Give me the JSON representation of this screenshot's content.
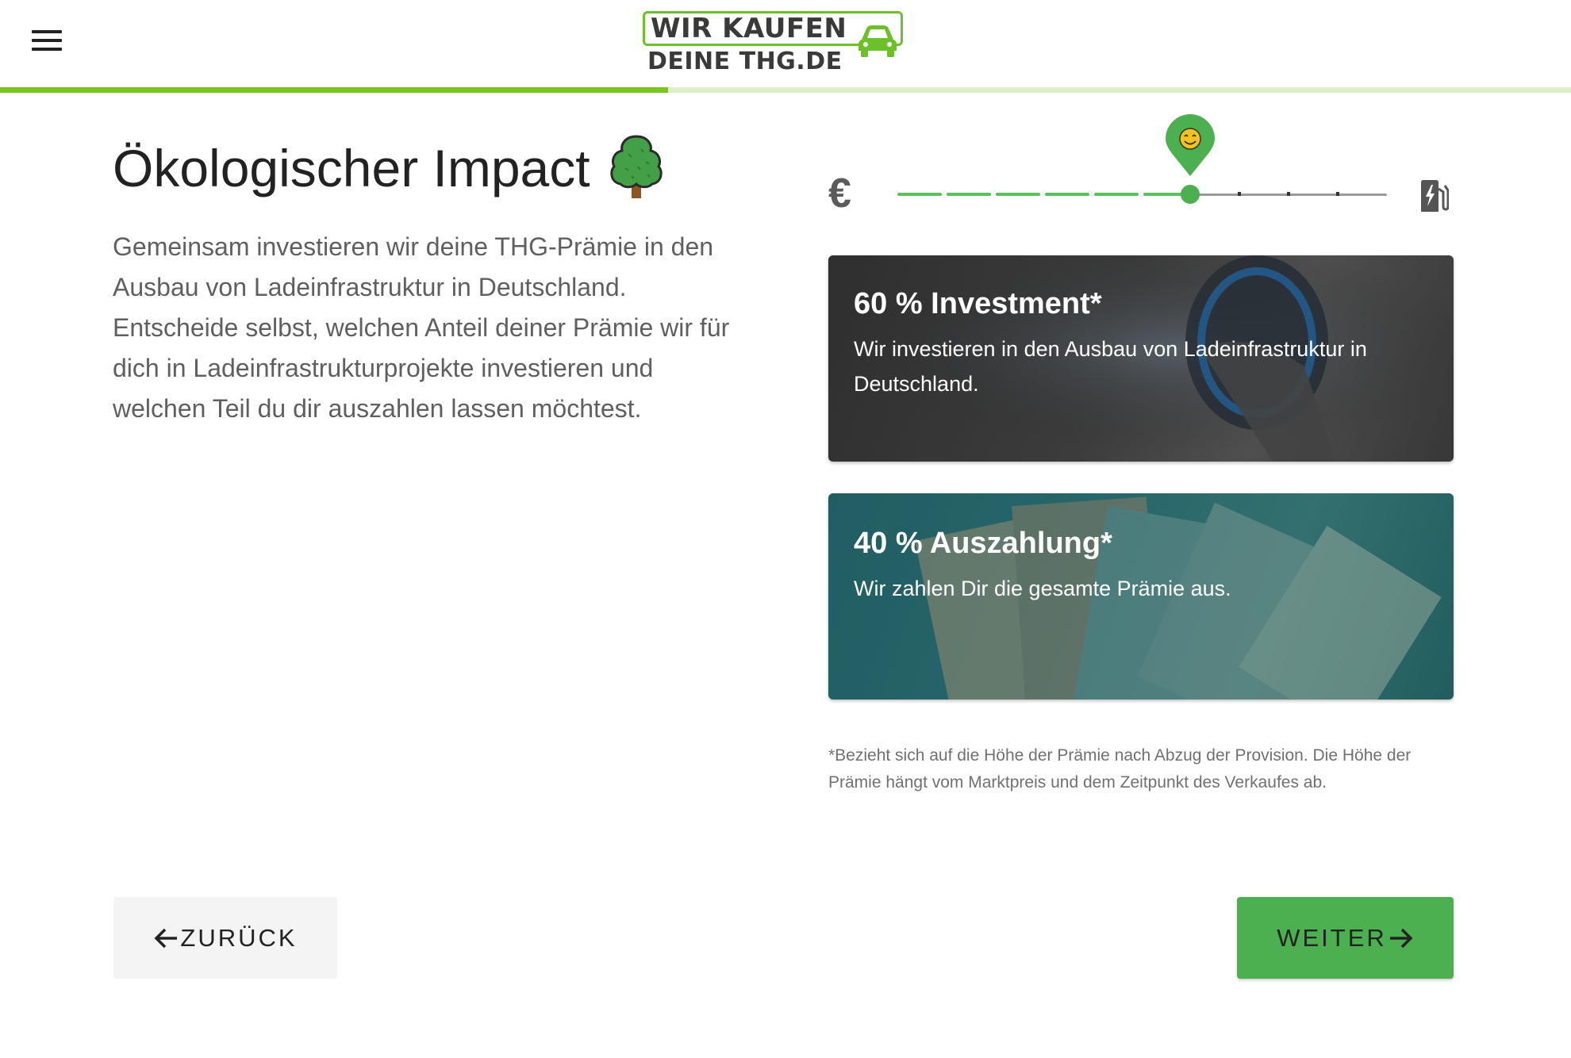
{
  "header": {
    "menu_icon": "hamburger-menu-icon",
    "logo_line1": "WIR KAUFEN",
    "logo_line2": "DEINE THG.DE",
    "logo_icon": "car-icon",
    "progress": 0.425
  },
  "main": {
    "title": "Ökologischer Impact",
    "title_icon": "tree-icon",
    "description": "Gemeinsam investieren wir deine THG-Prämie in den Ausbau von Ladeinfrastruktur in Deutschland. Entscheide selbst, welchen Anteil deiner Prämie wir für dich in Ladeinfrastrukturprojekte investieren und welchen Teil du dir auszahlen lassen möchtest."
  },
  "slider": {
    "left_icon": "euro-icon",
    "left_symbol": "€",
    "right_icon": "ev-charging-station-icon",
    "marker_icon": "smiley-pin-icon",
    "steps": 10,
    "value_step": 6
  },
  "cards": {
    "investment": {
      "title": "60 % Investment*",
      "text": "Wir investieren in den Ausbau von Ladeinfrastruktur in Deutschland."
    },
    "payout": {
      "title": "40 % Auszahlung*",
      "text": "Wir zahlen Dir die gesamte Prämie aus."
    }
  },
  "footnote": "*Bezieht sich auf die Höhe der Prämie nach Abzug der Provision. Die Höhe der Prämie hängt vom Marktpreis und dem Zeitpunkt des Verkaufes ab.",
  "buttons": {
    "back_label": "ZURÜCK",
    "back_icon": "arrow-left-icon",
    "next_label": "WEITER",
    "next_icon": "arrow-right-icon"
  },
  "colors": {
    "accent_green": "#4caf50",
    "progress_green": "#7ac41e",
    "progress_track": "#dcefc8"
  }
}
